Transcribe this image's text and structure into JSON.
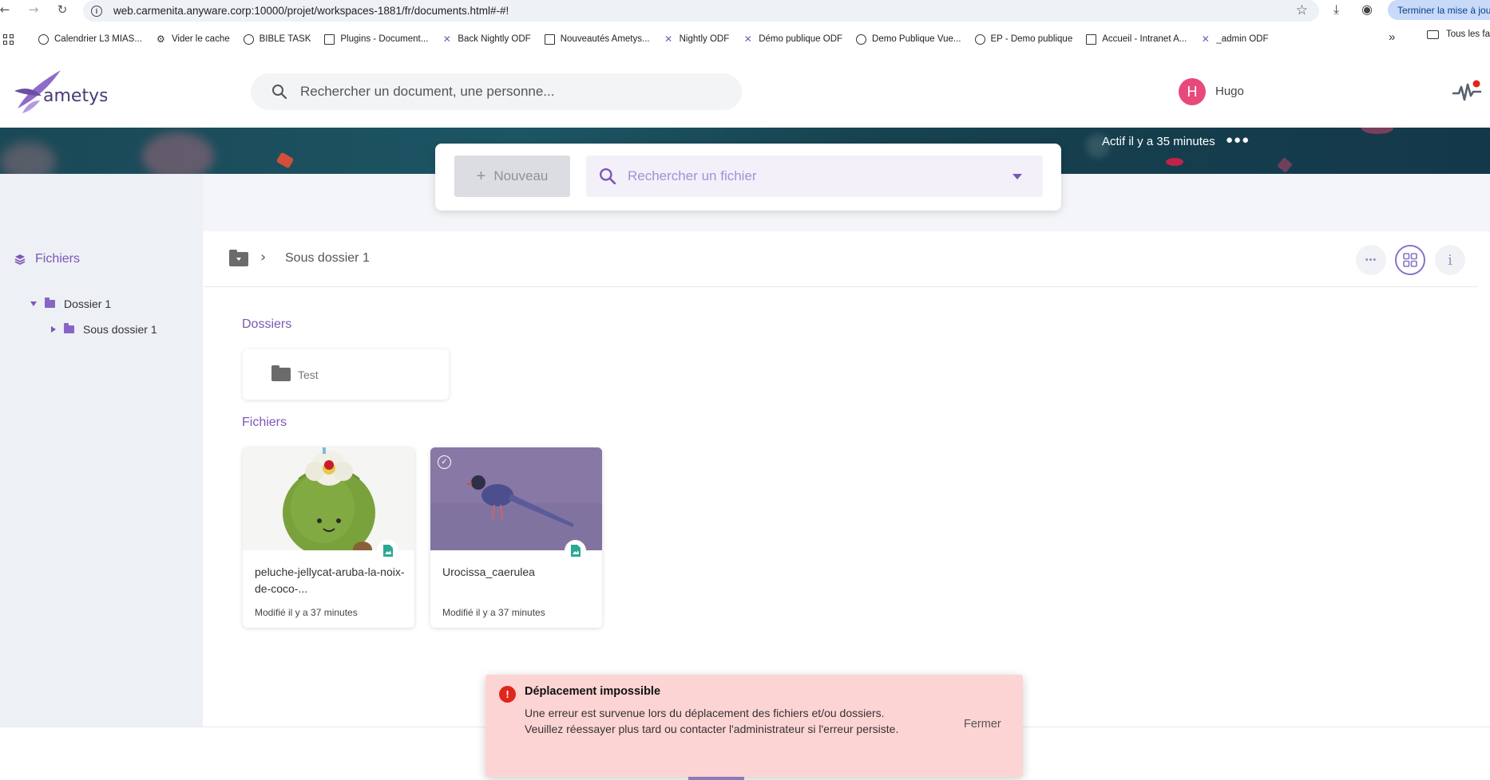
{
  "browser": {
    "url": "web.carmenita.anyware.corp:10000/projet/workspaces-1881/fr/documents.html#-#!",
    "update_label": "Terminer la mise à jour",
    "bookmarks": [
      {
        "label": "Calendrier L3 MIAS...",
        "icon": "globe-icon"
      },
      {
        "label": "Vider le cache",
        "icon": "gear-icon"
      },
      {
        "label": "BIBLE TASK",
        "icon": "globe-icon"
      },
      {
        "label": "Plugins - Document...",
        "icon": "doc-icon"
      },
      {
        "label": "Back Nightly ODF",
        "icon": "butterfly-icon"
      },
      {
        "label": "Nouveautés Ametys...",
        "icon": "doc-icon"
      },
      {
        "label": "Nightly ODF",
        "icon": "butterfly-icon"
      },
      {
        "label": "Démo publique ODF",
        "icon": "butterfly-icon"
      },
      {
        "label": "Demo Publique Vue...",
        "icon": "globe-icon"
      },
      {
        "label": "EP - Demo publique",
        "icon": "globe-icon"
      },
      {
        "label": "Accueil - Intranet A...",
        "icon": "doc-icon"
      },
      {
        "label": "_admin ODF",
        "icon": "butterfly-icon"
      }
    ],
    "more_label": "»",
    "all_bookmarks_label": "Tous les favoris"
  },
  "header": {
    "logo_text": "ametys",
    "search_placeholder": "Rechercher un document, une personne...",
    "avatar_initial": "H",
    "user_name": "Hugo"
  },
  "banner": {
    "status": "Actif il y a 35 minutes",
    "dots": "●●●"
  },
  "sidebar": {
    "title": "Fichiers",
    "tree": [
      {
        "label": "Dossier 1",
        "expanded": true
      },
      {
        "label": "Sous dossier 1",
        "expanded": false
      }
    ]
  },
  "actions": {
    "new_label": "Nouveau",
    "file_search_placeholder": "Rechercher un fichier"
  },
  "breadcrumb": {
    "separator": "›",
    "current": "Sous dossier 1"
  },
  "sections": {
    "folders_label": "Dossiers",
    "files_label": "Fichiers"
  },
  "folders": [
    {
      "name": "Test"
    }
  ],
  "files": [
    {
      "name": "peluche-jellycat-aruba-la-noix-de-coco-...",
      "modified": "Modifié il y a 37 minutes"
    },
    {
      "name": "Urocissa_caerulea",
      "modified": "Modifié il y a 37 minutes"
    }
  ],
  "toast": {
    "title": "Déplacement impossible",
    "message": "Une erreur est survenue lors du déplacement des fichiers et/ou dossiers. Veuillez réessayer plus tard ou contacter l'administrateur si l'erreur persiste.",
    "close_label": "Fermer"
  },
  "colors": {
    "brand": "#7c57b4",
    "banner": "#1d5564",
    "avatar": "#e8497b",
    "error": "#e0251c",
    "toast_bg": "#fdd4d4"
  }
}
